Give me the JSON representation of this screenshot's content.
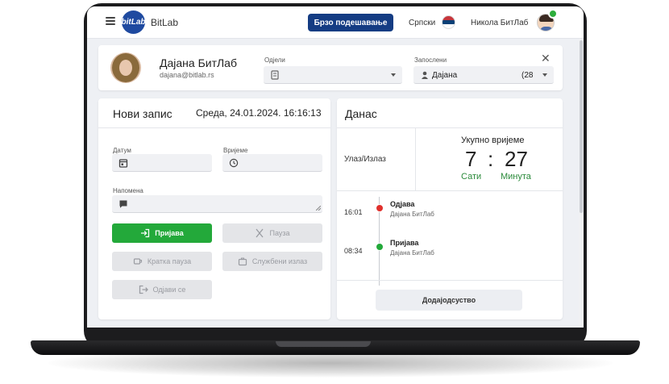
{
  "colors": {
    "brand": "#143c83",
    "success": "#23a93a",
    "danger": "#e0302c",
    "online": "#2eae3c"
  },
  "header": {
    "menu_icon": "hamburger-menu-icon",
    "logo_text": "bitLab",
    "brand": "BitLab",
    "quick_setup_label": "Брзо подешавање",
    "language": "Српски",
    "language_icon": "serbia-flag-icon",
    "user_name": "Никола БитЛаб"
  },
  "profile": {
    "name": "Дајана БитЛаб",
    "email": "dajana@bitlab.rs",
    "departments_label": "Одјели",
    "departments_value": "",
    "employees_label": "Запослени",
    "employees_value": "Дајана",
    "employees_count": "(28",
    "close_icon": "close-icon"
  },
  "entry": {
    "title": "Нови запис",
    "datetime": "Среда, 24.01.2024. 16:16:13",
    "date_label": "Датум",
    "time_label": "Вријеме",
    "note_label": "Напомена",
    "buttons": {
      "check_in": "Пријава",
      "pause": "Пауза",
      "short_pause": "Кратка пауза",
      "business_exit": "Службени излаз",
      "check_out": "Одјави се"
    }
  },
  "today": {
    "title": "Данас",
    "in_out_label": "Улаз/Излаз",
    "total_label": "Укупно вријеме",
    "hours": "7",
    "separator": ":",
    "minutes": "27",
    "hours_unit": "Сати",
    "minutes_unit": "Минута",
    "events": [
      {
        "time": "16:01",
        "title": "Одјава",
        "user": "Дајана БитЛаб",
        "status": "danger"
      },
      {
        "time": "08:34",
        "title": "Пријава",
        "user": "Дајана БитЛаб",
        "status": "success"
      }
    ],
    "add_absence_label": "Додајодсуство"
  }
}
